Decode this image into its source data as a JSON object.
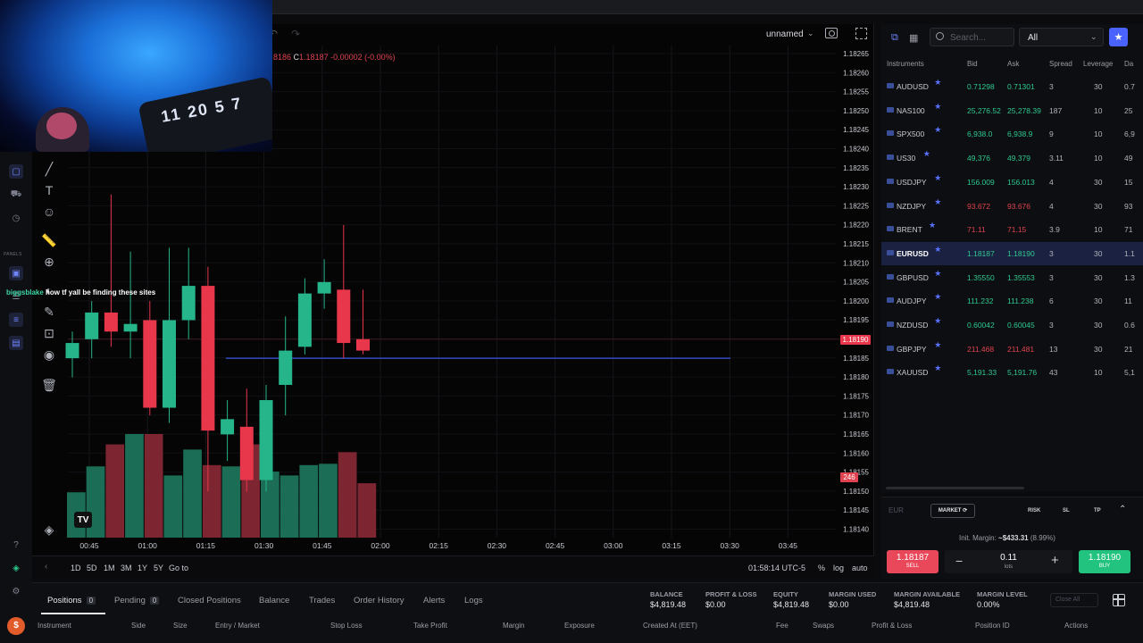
{
  "chart": {
    "layout_name": "unnamed",
    "ohlc_partial": "8186",
    "ohlc_close_label": "C",
    "ohlc_close_value": "1.18187",
    "ohlc_change": "-0.00002 (-0.00%)",
    "current_price_tag": "1.18190",
    "volume_tag": "246",
    "price_axis": [
      "1.18265",
      "1.18260",
      "1.18255",
      "1.18250",
      "1.18245",
      "1.18240",
      "1.18235",
      "1.18230",
      "1.18225",
      "1.18220",
      "1.18215",
      "1.18210",
      "1.18205",
      "1.18200",
      "1.18195",
      "1.18190",
      "1.18185",
      "1.18180",
      "1.18175",
      "1.18170",
      "1.18165",
      "1.18160",
      "1.18155",
      "1.18150",
      "1.18145",
      "1.18140"
    ],
    "time_axis": [
      "00:45",
      "01:00",
      "01:15",
      "01:30",
      "01:45",
      "02:00",
      "02:15",
      "02:30",
      "02:45",
      "03:00",
      "03:15",
      "03:30",
      "03:45"
    ],
    "timeframes": [
      "1D",
      "5D",
      "1M",
      "3M",
      "1Y",
      "5Y"
    ],
    "goto_label": "Go to",
    "clock": "01:58:14 UTC-5",
    "pct_label": "%",
    "log_label": "log",
    "auto_label": "auto",
    "tv_logo": "TV"
  },
  "chart_data": {
    "type": "candlestick",
    "interval_minutes": 5,
    "ylim": [
      1.1814,
      1.18265
    ],
    "candles": [
      {
        "o": 1.18185,
        "h": 1.18192,
        "l": 1.1818,
        "c": 1.18189,
        "vol_dir": "up"
      },
      {
        "o": 1.1819,
        "h": 1.182,
        "l": 1.18185,
        "c": 1.18197,
        "vol_dir": "up"
      },
      {
        "o": 1.18197,
        "h": 1.18228,
        "l": 1.18188,
        "c": 1.18192,
        "vol_dir": "down"
      },
      {
        "o": 1.18192,
        "h": 1.18213,
        "l": 1.18185,
        "c": 1.18194,
        "vol_dir": "up"
      },
      {
        "o": 1.18195,
        "h": 1.182,
        "l": 1.1817,
        "c": 1.18172,
        "vol_dir": "down"
      },
      {
        "o": 1.18172,
        "h": 1.18214,
        "l": 1.18168,
        "c": 1.18195,
        "vol_dir": "up"
      },
      {
        "o": 1.18195,
        "h": 1.18214,
        "l": 1.1819,
        "c": 1.18204,
        "vol_dir": "up"
      },
      {
        "o": 1.18204,
        "h": 1.18209,
        "l": 1.1815,
        "c": 1.18166,
        "vol_dir": "down"
      },
      {
        "o": 1.18165,
        "h": 1.18174,
        "l": 1.18158,
        "c": 1.18169,
        "vol_dir": "up"
      },
      {
        "o": 1.18167,
        "h": 1.18177,
        "l": 1.1815,
        "c": 1.18153,
        "vol_dir": "down"
      },
      {
        "o": 1.18153,
        "h": 1.18178,
        "l": 1.1815,
        "c": 1.18174,
        "vol_dir": "up"
      },
      {
        "o": 1.18178,
        "h": 1.18196,
        "l": 1.1817,
        "c": 1.18187,
        "vol_dir": "up"
      },
      {
        "o": 1.18188,
        "h": 1.18206,
        "l": 1.18186,
        "c": 1.18202,
        "vol_dir": "up"
      },
      {
        "o": 1.18202,
        "h": 1.18211,
        "l": 1.18198,
        "c": 1.18205,
        "vol_dir": "up"
      },
      {
        "o": 1.18203,
        "h": 1.1822,
        "l": 1.18185,
        "c": 1.18189,
        "vol_dir": "down"
      },
      {
        "o": 1.1819,
        "h": 1.18203,
        "l": 1.18186,
        "c": 1.18187,
        "vol_dir": "down"
      }
    ],
    "volume_levels": [
      0.35,
      0.55,
      0.72,
      0.8,
      0.8,
      0.48,
      0.68,
      0.56,
      0.55,
      0.72,
      0.51,
      0.48,
      0.56,
      0.57,
      0.66,
      0.42
    ],
    "level_line": 1.18185,
    "current_price": 1.1819
  },
  "stream": {
    "chat_user": "biggsblake",
    "chat_text": "how tf yall be finding these sites",
    "jersey_text": "11 20 5 7"
  },
  "rail": {
    "panels_label": "PANELS"
  },
  "instruments": {
    "search_placeholder": "Search...",
    "filter_value": "All",
    "headers": {
      "instrument": "Instruments",
      "bid": "Bid",
      "ask": "Ask",
      "spread": "Spread",
      "leverage": "Leverage",
      "day": "Da"
    },
    "rows": [
      {
        "name": "AUDUSD",
        "bid": "0.71298",
        "ask": "0.71301",
        "spread": "3",
        "lev": "30",
        "day": "0.7",
        "dir": "green"
      },
      {
        "name": "NAS100",
        "bid": "25,276.52",
        "ask": "25,278.39",
        "spread": "187",
        "lev": "10",
        "day": "25",
        "dir": "green"
      },
      {
        "name": "SPX500",
        "bid": "6,938.0",
        "ask": "6,938.9",
        "spread": "9",
        "lev": "10",
        "day": "6,9",
        "dir": "green"
      },
      {
        "name": "US30",
        "bid": "49,376",
        "ask": "49,379",
        "spread": "3.11",
        "lev": "10",
        "day": "49",
        "dir": "green"
      },
      {
        "name": "USDJPY",
        "bid": "156.009",
        "ask": "156.013",
        "spread": "4",
        "lev": "30",
        "day": "15",
        "dir": "green"
      },
      {
        "name": "NZDJPY",
        "bid": "93.672",
        "ask": "93.676",
        "spread": "4",
        "lev": "30",
        "day": "93",
        "dir": "red"
      },
      {
        "name": "BRENT",
        "bid": "71.11",
        "ask": "71.15",
        "spread": "3.9",
        "lev": "10",
        "day": "71",
        "dir": "red"
      },
      {
        "name": "EURUSD",
        "bid": "1.18187",
        "ask": "1.18190",
        "spread": "3",
        "lev": "30",
        "day": "1.1",
        "dir": "green"
      },
      {
        "name": "GBPUSD",
        "bid": "1.35550",
        "ask": "1.35553",
        "spread": "3",
        "lev": "30",
        "day": "1.3",
        "dir": "green"
      },
      {
        "name": "AUDJPY",
        "bid": "111.232",
        "ask": "111.238",
        "spread": "6",
        "lev": "30",
        "day": "11",
        "dir": "green"
      },
      {
        "name": "NZDUSD",
        "bid": "0.60042",
        "ask": "0.60045",
        "spread": "3",
        "lev": "30",
        "day": "0.6",
        "dir": "green"
      },
      {
        "name": "GBPJPY",
        "bid": "211.468",
        "ask": "211.481",
        "spread": "13",
        "lev": "30",
        "day": "21",
        "dir": "red"
      },
      {
        "name": "XAUUSD",
        "bid": "5,191.33",
        "ask": "5,191.76",
        "spread": "43",
        "lev": "10",
        "day": "5,1",
        "dir": "green"
      }
    ]
  },
  "order": {
    "symbol": "EUR",
    "market_label": "MARKET",
    "risk_label": "RISK",
    "sl_label": "SL",
    "tp_label": "TP",
    "margin_label": "Init. Margin:",
    "margin_value": "~$433.31",
    "margin_pct": "(8.99%)",
    "sell_price": "1.18187",
    "sell_label": "SELL",
    "buy_price": "1.18190",
    "buy_label": "BUY",
    "lots_value": "0.11",
    "lots_unit": "lots"
  },
  "bottom": {
    "tabs": [
      {
        "label": "Positions",
        "badge": "0"
      },
      {
        "label": "Pending",
        "badge": "0"
      },
      {
        "label": "Closed Positions"
      },
      {
        "label": "Balance"
      },
      {
        "label": "Trades"
      },
      {
        "label": "Order History"
      },
      {
        "label": "Alerts"
      },
      {
        "label": "Logs"
      }
    ],
    "account": [
      {
        "k": "BALANCE",
        "v": "$4,819.48"
      },
      {
        "k": "PROFIT & LOSS",
        "v": "$0.00"
      },
      {
        "k": "EQUITY",
        "v": "$4,819.48"
      },
      {
        "k": "MARGIN USED",
        "v": "$0.00"
      },
      {
        "k": "MARGIN AVAILABLE",
        "v": "$4,819.48"
      },
      {
        "k": "MARGIN LEVEL",
        "v": "0.00%"
      }
    ],
    "close_all": "Close All",
    "columns": [
      "Instrument",
      "Side",
      "Size",
      "Entry / Market",
      "Stop Loss",
      "Take Profit",
      "Margin",
      "Exposure",
      "Created At (EET)",
      "Fee",
      "Swaps",
      "Profit & Loss",
      "Position ID",
      "Actions"
    ]
  },
  "colors": {
    "up": "#26b58a",
    "down": "#e8364b",
    "accent": "#4a63ff",
    "level_line": "#3a56e8"
  }
}
